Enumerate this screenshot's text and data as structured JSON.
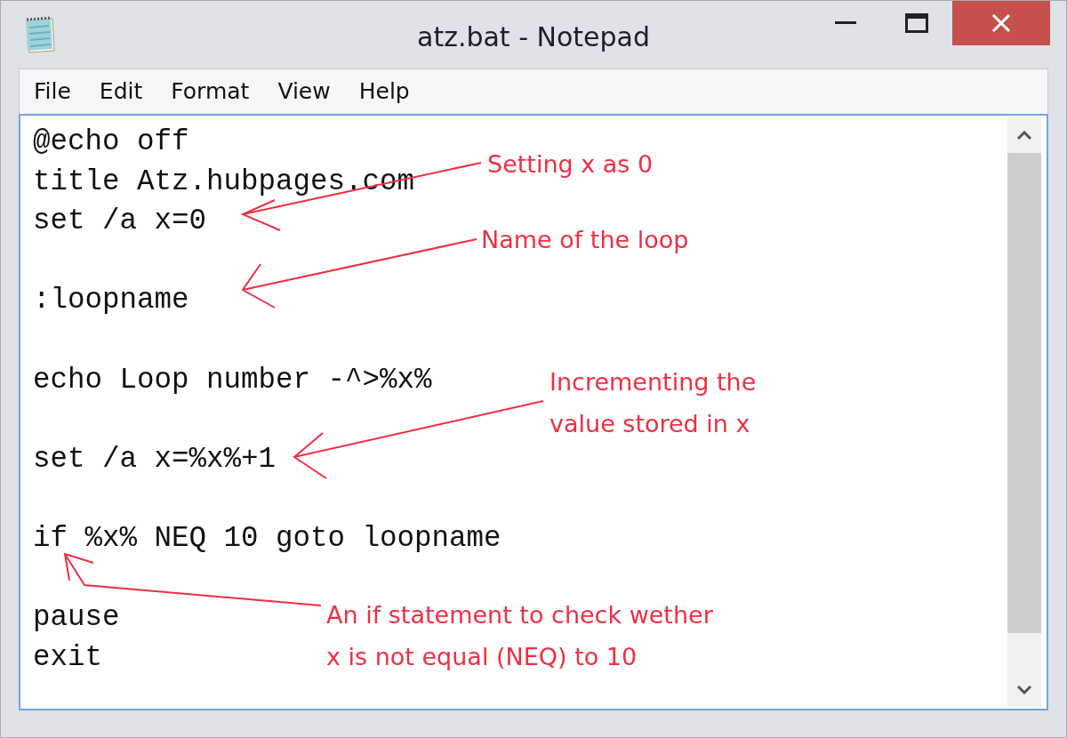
{
  "window": {
    "title": "atz.bat - Notepad"
  },
  "menu": [
    "File",
    "Edit",
    "Format",
    "View",
    "Help"
  ],
  "editor": {
    "paragraphs": [
      [
        "@echo off",
        "title Atz.hubpages.com",
        "set /a x=0"
      ],
      [
        ":loopname"
      ],
      [
        "echo Loop number -^>%x%"
      ],
      [
        "set /a x=%x%+1"
      ],
      [
        "if %x% NEQ 10 goto loopname"
      ],
      [
        "pause",
        "exit"
      ]
    ]
  },
  "annotations": [
    {
      "lines": [
        "Setting x as 0"
      ]
    },
    {
      "lines": [
        "Name of the loop"
      ]
    },
    {
      "lines": [
        "Incrementing the",
        "value stored in x"
      ]
    },
    {
      "lines": [
        "An if statement to check wether",
        "x is not equal (NEQ) to 10"
      ]
    }
  ]
}
